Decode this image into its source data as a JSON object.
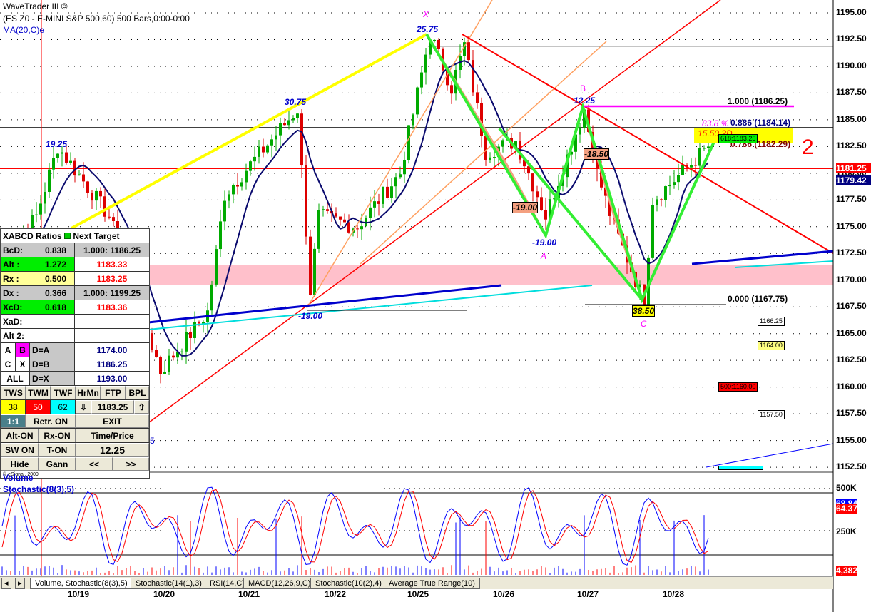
{
  "header": {
    "title": "WaveTrader III ©",
    "symbol": "(ES Z0 - E-MINI S&P 500,60) 500 Bars,0:00-0:00",
    "ma": "MA(20,C)e"
  },
  "panel": {
    "title": "XABCD Ratios",
    "next_target": "Next Target",
    "rows": [
      {
        "label": "BcD:",
        "ratio": "0.838",
        "target": "1.000: 1186.25"
      },
      {
        "label": "Alt  :",
        "ratio": "1.272",
        "target": "1183.33"
      },
      {
        "label": "Rx   :",
        "ratio": "0.500",
        "target": "1183.25"
      },
      {
        "label": "Dx   :",
        "ratio": "0.366",
        "target": "1.000: 1199.25"
      },
      {
        "label": "XcD:",
        "ratio": "0.618",
        "target": "1183.36"
      },
      {
        "label": "XaD:",
        "ratio": "",
        "target": ""
      },
      {
        "label": "Alt 2:",
        "ratio": "",
        "target": ""
      }
    ],
    "points": [
      {
        "a": "A",
        "b": "B",
        "eq": "D=A",
        "value": "1174.00"
      },
      {
        "a": "C",
        "b": "X",
        "eq": "D=B",
        "value": "1186.25"
      },
      {
        "a": "ALL",
        "b": "",
        "eq": "D=X",
        "value": "1193.00"
      }
    ],
    "buttons": {
      "tws": "TWS",
      "twm": "TWM",
      "twf": "TWF",
      "hrmn": "HrMn",
      "ftp": "FTP",
      "bpl": "BPL",
      "v38": "38",
      "v50": "50",
      "v62": "62",
      "down": "⇩",
      "price": "1183.25",
      "up": "⇧",
      "ratio11": "1:1",
      "retr": "Retr. ON",
      "exit": "EXIT",
      "alt_on": "Alt-ON",
      "rx_on": "Rx-ON",
      "time_price": "Time/Price",
      "sw_on": "SW ON",
      "t_on": "T-ON",
      "value": "12.25",
      "hide": "Hide",
      "gann": "Gann",
      "prev": "<<",
      "next": ">>"
    },
    "copyright": "© eSignal, 2009"
  },
  "labels": {
    "x": "X",
    "x_val": "25.75",
    "v3075": "30.75",
    "v1925": "19.25",
    "b": "B",
    "b_val": "12.25",
    "m1850": "-18.50",
    "m1900a": "-19.00",
    "m1900b": "-19.00",
    "m1900c": "-19.00",
    "a": "A",
    "c": "C",
    "c_val": "38.50",
    "fib1": "1.000 (1186.25)",
    "fib886": "0.886 (1184.14)",
    "fib786": "0.786 (1182.29)",
    "fib0": "0.000 (1167.75)",
    "pct": "83.8 %",
    "d2": "15.50 2D",
    "t618": "618:1183.25",
    "b1": "1166.25",
    "b2": "1164.00",
    "b3": "500:1160.00",
    "b4": "1157.50",
    "five": "5",
    "mark": "2"
  },
  "lower": {
    "volume": "Volume",
    "stoch": "Stochastic(8(3),5)",
    "v500": "500K",
    "v250": "250K",
    "k": "68.84",
    "d": "64.37",
    "vol": "4,382"
  },
  "tabs": [
    "Volume, Stochastic(8(3),5)",
    "Stochastic(14(1),3)",
    "RSI(14,C)",
    "MACD(12,26,9,C)",
    "Stochastic(10(2),4)",
    "Average True Range(10)"
  ],
  "chart_data": {
    "type": "candlestick",
    "title": "ES Z0 - E-MINI S&P 500, 60 min",
    "x_ticks": [
      "10/19",
      "10/20",
      "10/21",
      "10/22",
      "10/25",
      "10/26",
      "10/27",
      "10/28"
    ],
    "y_ticks": [
      "1195.00",
      "1192.50",
      "1190.00",
      "1187.50",
      "1185.00",
      "1182.50",
      "1180.00",
      "1177.50",
      "1175.00",
      "1172.50",
      "1170.00",
      "1167.50",
      "1165.00",
      "1162.50",
      "1160.00",
      "1157.50",
      "1155.00",
      "1152.50"
    ],
    "ylim": [
      1152.5,
      1195
    ],
    "last_price": "1181.25",
    "ma_value": "1179.42",
    "price_anchors": [
      [
        0,
        1172
      ],
      [
        8,
        1176
      ],
      [
        13,
        1182.5
      ],
      [
        25,
        1176
      ],
      [
        37,
        1161.5
      ],
      [
        48,
        1167
      ],
      [
        52,
        1178
      ],
      [
        69,
        1186
      ],
      [
        72,
        1169
      ],
      [
        74,
        1176
      ],
      [
        83,
        1175
      ],
      [
        93,
        1180
      ],
      [
        100,
        1193
      ],
      [
        105,
        1188
      ],
      [
        108,
        1192
      ],
      [
        113,
        1182
      ],
      [
        120,
        1183
      ],
      [
        127,
        1176
      ],
      [
        136,
        1186
      ],
      [
        139,
        1180
      ],
      [
        143,
        1175
      ],
      [
        150,
        1168
      ],
      [
        152,
        1177.5
      ],
      [
        160,
        1180.5
      ],
      [
        165,
        1182.5
      ]
    ]
  }
}
